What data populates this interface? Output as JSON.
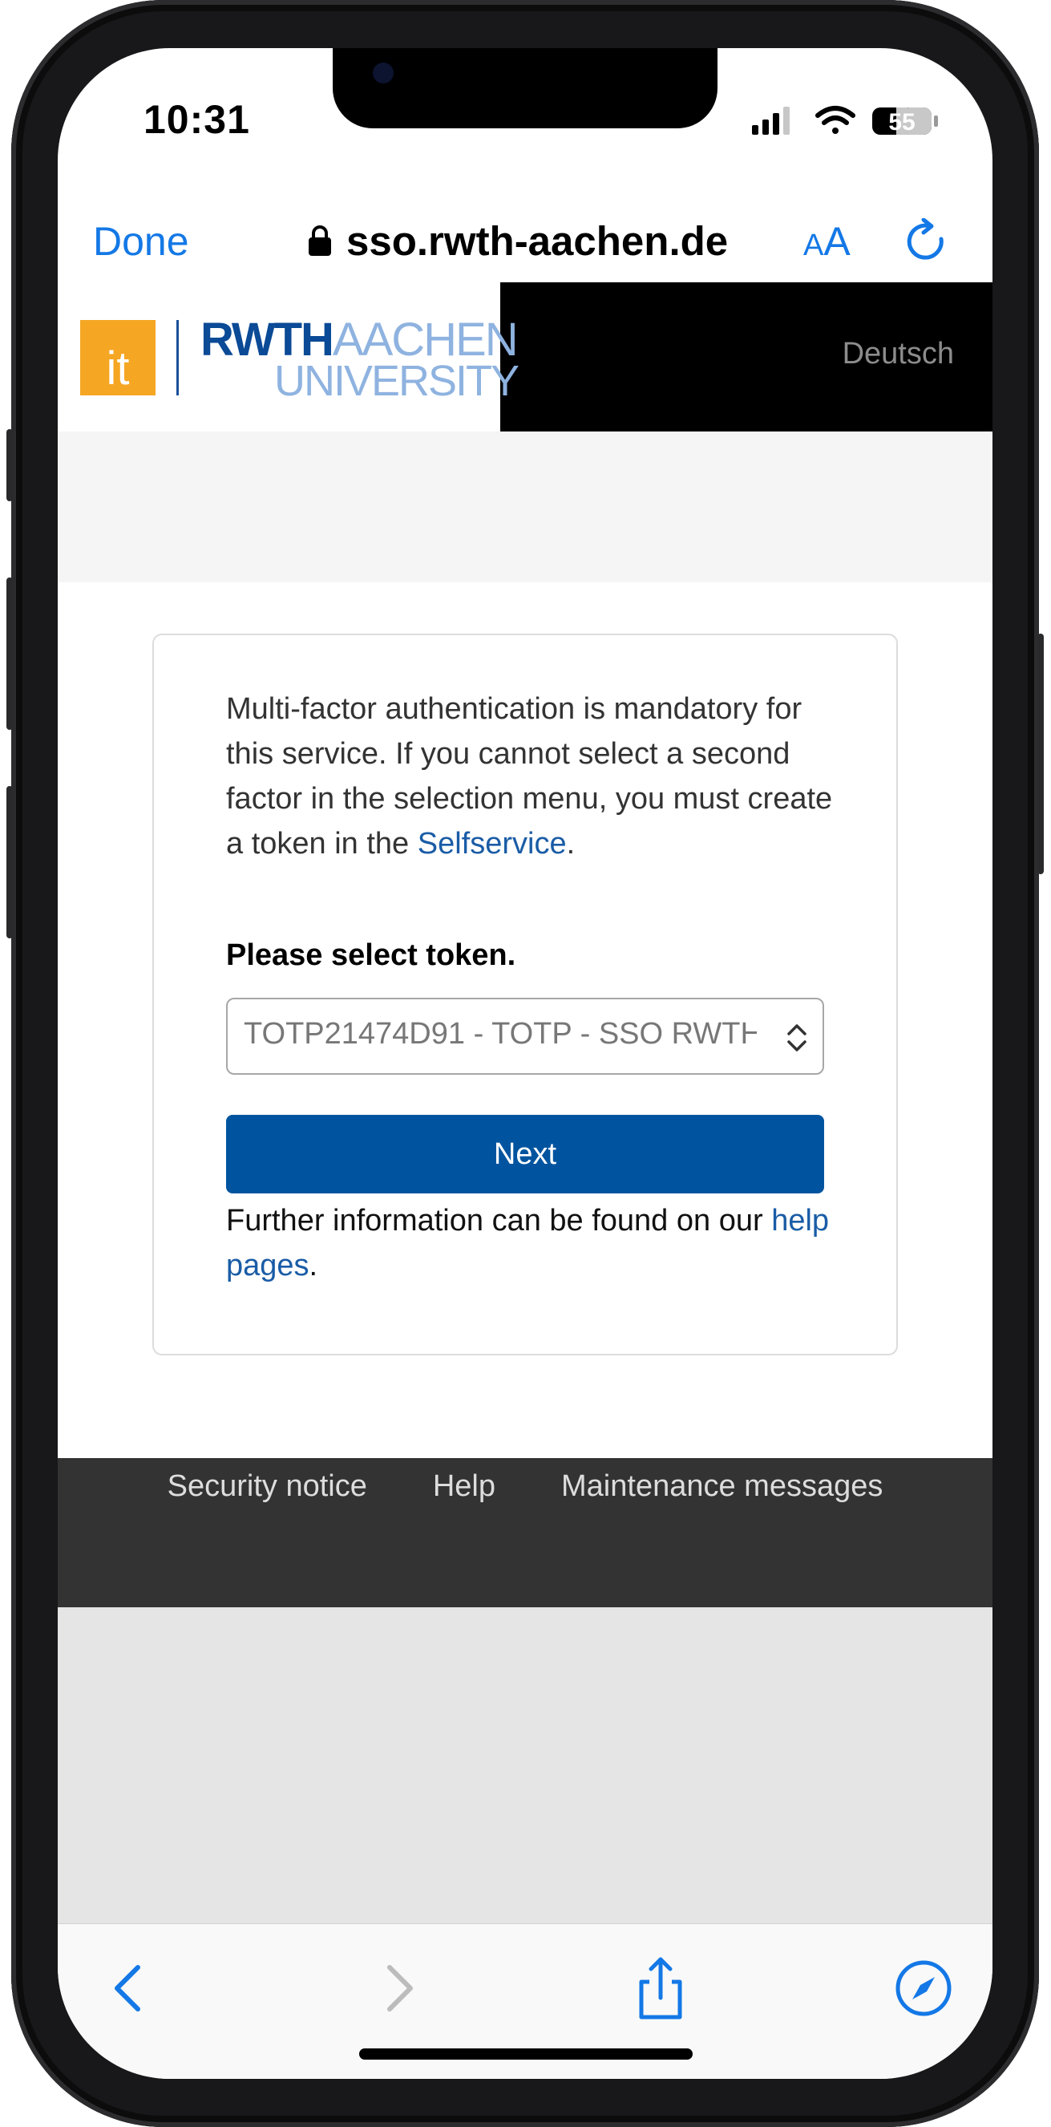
{
  "status_bar": {
    "time": "10:31",
    "battery": "55"
  },
  "browser": {
    "done_label": "Done",
    "url": "sso.rwth-aachen.de",
    "text_size_label_small": "A",
    "text_size_label_big": "A"
  },
  "header": {
    "logo_it": "it",
    "logo_rwth": "RWTH",
    "logo_aachen": "AACHEN",
    "logo_university": "UNIVERSITY",
    "language_link": "Deutsch"
  },
  "main": {
    "info_text": "Multi-factor authentication is mandatory for this service. If you cannot select a second factor in the selection menu, you must create a token in the ",
    "selfservice_link": "Selfservice",
    "info_end": ".",
    "select_label": "Please select token.",
    "selected_token": "TOTP21474D91 - TOTP - SSO RWTH",
    "next_label": "Next",
    "further_text": "Further information can be found on our ",
    "help_link": "help pages",
    "further_end": "."
  },
  "footer": {
    "links": [
      "Security notice",
      "Help",
      "Maintenance messages"
    ]
  },
  "colors": {
    "ios_blue": "#1478e6",
    "rwth_blue": "#00549f",
    "it_orange": "#f5a623"
  },
  "icons": {
    "back": "chevron-left-icon",
    "forward": "chevron-right-icon",
    "share": "share-icon",
    "bookmarks": "compass-icon"
  }
}
